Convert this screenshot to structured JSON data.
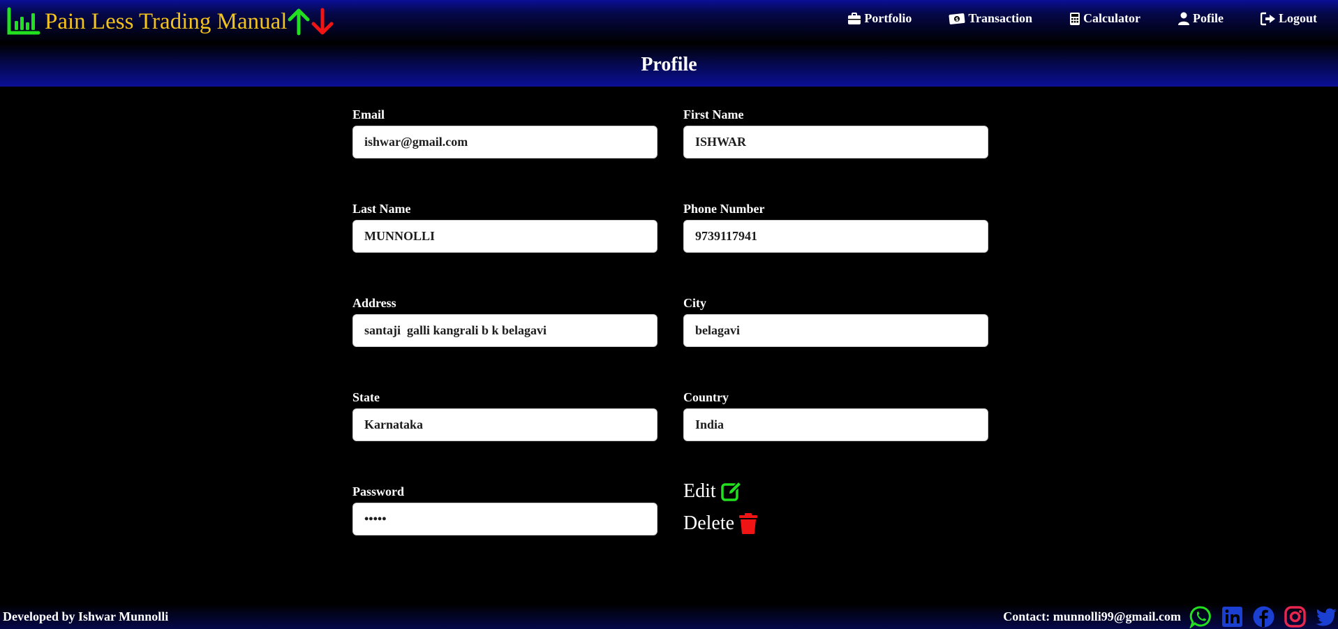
{
  "header": {
    "brand_title": "Pain Less Trading Manual",
    "brand_color": "#f2c21d",
    "icons": [
      "bar-chart-icon",
      "arrow-up-icon",
      "arrow-down-icon"
    ],
    "nav": [
      {
        "label": "Portfolio",
        "icon": "briefcase-icon"
      },
      {
        "label": "Transaction",
        "icon": "money-icon"
      },
      {
        "label": "Calculator",
        "icon": "calculator-icon"
      },
      {
        "label": "Pofile",
        "icon": "user-icon"
      },
      {
        "label": "Logout",
        "icon": "logout-icon"
      }
    ]
  },
  "page": {
    "title": "Profile"
  },
  "form": {
    "email": {
      "label": "Email",
      "value": "ishwar@gmail.com"
    },
    "first_name": {
      "label": "First Name",
      "value": "ISHWAR"
    },
    "last_name": {
      "label": "Last Name",
      "value": "MUNNOLLI"
    },
    "phone": {
      "label": "Phone Number",
      "value": "9739117941"
    },
    "address": {
      "label": "Address",
      "value": "santaji  galli kangrali b k belagavi"
    },
    "city": {
      "label": "City",
      "value": "belagavi"
    },
    "state": {
      "label": "State",
      "value": "Karnataka"
    },
    "country": {
      "label": "Country",
      "value": "India"
    },
    "password": {
      "label": "Password",
      "value": "•••••"
    }
  },
  "actions": {
    "edit_label": "Edit",
    "delete_label": "Delete",
    "edit_color": "#22e01f",
    "delete_color": "#f01414"
  },
  "footer": {
    "credit": "Developed by Ishwar Munnolli",
    "contact": "Contact: munnolli99@gmail.com",
    "socials": [
      "whatsapp-icon",
      "linkedin-icon",
      "facebook-icon",
      "instagram-icon",
      "twitter-icon"
    ]
  }
}
